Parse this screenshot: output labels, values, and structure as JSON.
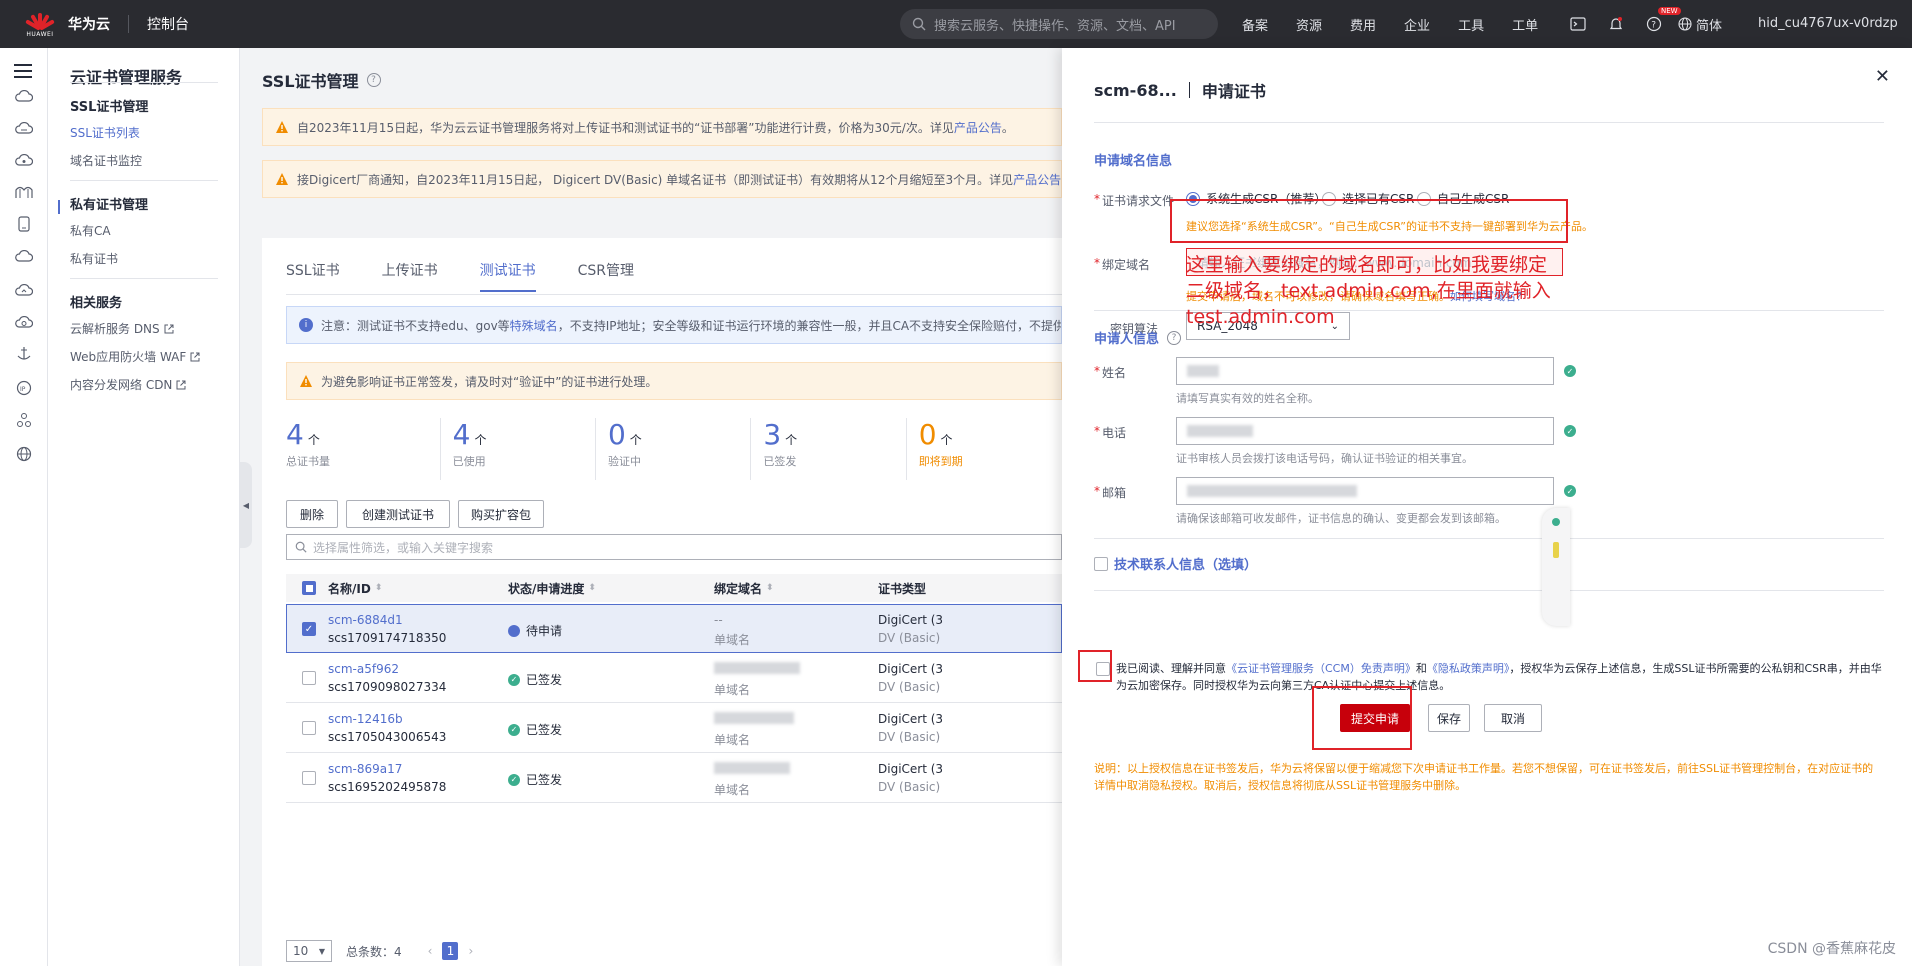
{
  "topbar": {
    "logo_text": "HUAWEI",
    "brand": "华为云",
    "console": "控制台",
    "search_placeholder": "搜索云服务、快捷操作、资源、文档、API",
    "nav": [
      "备案",
      "资源",
      "费用",
      "企业",
      "工具",
      "工单"
    ],
    "new_badge": "NEW",
    "lang": "简体",
    "user": "hid_cu4767ux-v0rdzp"
  },
  "menu": {
    "title": "云证书管理服务",
    "sections": [
      {
        "title": "SSL证书管理",
        "items": [
          "SSL证书列表",
          "域名证书监控"
        ]
      },
      {
        "title": "私有证书管理",
        "items": [
          "私有CA",
          "私有证书"
        ]
      },
      {
        "title": "相关服务",
        "items": [
          "云解析服务 DNS",
          "Web应用防火墙 WAF",
          "内容分发网络 CDN"
        ]
      }
    ]
  },
  "main": {
    "title": "SSL证书管理",
    "notice1_text": "自2023年11月15日起，华为云云证书管理服务将对上传证书和测试证书的“证书部署”功能进行计费，价格为30元/次。详见",
    "notice1_link": "产品公告",
    "notice1_end": "。",
    "notice2_text": "接Digicert厂商通知，自2023年11月15日起， Digicert DV(Basic) 单域名证书（即测试证书）有效期将从12个月缩短至3个月。详见",
    "notice2_link": "产品公告",
    "notice2_end": "。",
    "tabs": [
      "SSL证书",
      "上传证书",
      "测试证书",
      "CSR管理"
    ],
    "info_text1": "注意：测试证书不支持edu、gov等",
    "info_link": "特殊域名",
    "info_text2": "，不支持IP地址；安全等级和证书运行环境的兼容性一般，并且CA不支持安全保险赔付，不提供",
    "warn_text": "为避免影响证书正常签发，请及时对“验证中”的证书进行处理。",
    "stats": [
      {
        "num": "4",
        "unit": "个",
        "label": "总证书量"
      },
      {
        "num": "4",
        "unit": "个",
        "label": "已使用"
      },
      {
        "num": "0",
        "unit": "个",
        "label": "验证中"
      },
      {
        "num": "3",
        "unit": "个",
        "label": "已签发"
      },
      {
        "num": "0",
        "unit": "个",
        "label": "即将到期"
      }
    ],
    "buttons": {
      "delete": "删除",
      "create": "创建测试证书",
      "buy": "购买扩容包"
    },
    "filter_placeholder": "选择属性筛选，或输入关键字搜索",
    "columns": [
      "名称/ID",
      "状态/申请进度",
      "绑定域名",
      "证书类型"
    ],
    "rows": [
      {
        "name": "scm-6884d1",
        "id": "scs1709174718350",
        "status": "待申请",
        "domain": "--",
        "domain_type": "单域名",
        "type1": "DigiCert (3",
        "type2": "DV (Basic)"
      },
      {
        "name": "scm-a5f962",
        "id": "scs1709098027334",
        "status": "已签发",
        "domain": "",
        "domain_type": "单域名",
        "type1": "DigiCert (3",
        "type2": "DV (Basic)"
      },
      {
        "name": "scm-12416b",
        "id": "scs1705043006543",
        "status": "已签发",
        "domain": "",
        "domain_type": "单域名",
        "type1": "DigiCert (3",
        "type2": "DV (Basic)"
      },
      {
        "name": "scm-869a17",
        "id": "scs1695202495878",
        "status": "已签发",
        "domain": "",
        "domain_type": "单域名",
        "type1": "DigiCert (3",
        "type2": "DV (Basic)"
      }
    ],
    "pager": {
      "size": "10",
      "total": "总条数：4",
      "page": "1"
    }
  },
  "drawer": {
    "cert_name": "scm-68...",
    "title": "申请证书",
    "sec1": "申请域名信息",
    "csr_label": "证书请求文件",
    "csr_options": [
      "系统生成CSR（推荐）",
      "选择已有CSR",
      "自己生成CSR"
    ],
    "csr_hint": "建议您选择“系统生成CSR”。“自己生成CSR”的证书不支持一键部署到华为云产品。",
    "domain_label": "绑定域名",
    "domain_placeholder": "请输入证书绑定的域名，例如：www.domain.com",
    "domain_hint": "提交申请后，域名不可以修改，请确保域名填写正确。",
    "domain_hint_link": "如何填写域名？",
    "algo_label": "密钥算法",
    "algo_value": "RSA_2048",
    "sec2": "申请人信息",
    "name_label": "姓名",
    "name_hint": "请填写真实有效的姓名全称。",
    "phone_label": "电话",
    "phone_hint": "证书审核人员会拨打该电话号码，确认证书验证的相关事宜。",
    "email_label": "邮箱",
    "email_hint": "请确保该邮箱可收发邮件，证书信息的确认、变更都会发到该邮箱。",
    "tech_contact": "技术联系人信息（选填）",
    "note": "说明：以上授权信息在证书签发后，华为云将保留以便于缩减您下次申请证书工作量。若您不想保留，可在证书签发后，前往SSL证书管理控制台，在对应证书的详情中取消隐私授权。取消后，授权信息将彻底从SSL证书管理服务中删除。",
    "agree_prefix": "我已阅读、理解并同意",
    "agree_link1": "《云证书管理服务（CCM）免责声明》",
    "agree_and": "和",
    "agree_link2": "《隐私政策声明》",
    "agree_suffix": "，授权华为云保存上述信息，生成SSL证书所需要的公私钥和CSR串，并由华为云加密保存。同时授权华为云向第三方CA认证中心提交上述信息。",
    "submit": "提交申请",
    "save": "保存",
    "cancel": "取消"
  },
  "annotation": "这里输入要绑定的域名即可，比如我要绑定二级域名，text.admin.com,在里面就输入test.admin.com",
  "watermark": "CSDN @香蕉麻花皮",
  "colors": {
    "accent": "#526ecc",
    "primary_button": "#c7000b",
    "warning": "#f08c00",
    "success": "#3cae8e",
    "topbar": "#2a2b30"
  }
}
